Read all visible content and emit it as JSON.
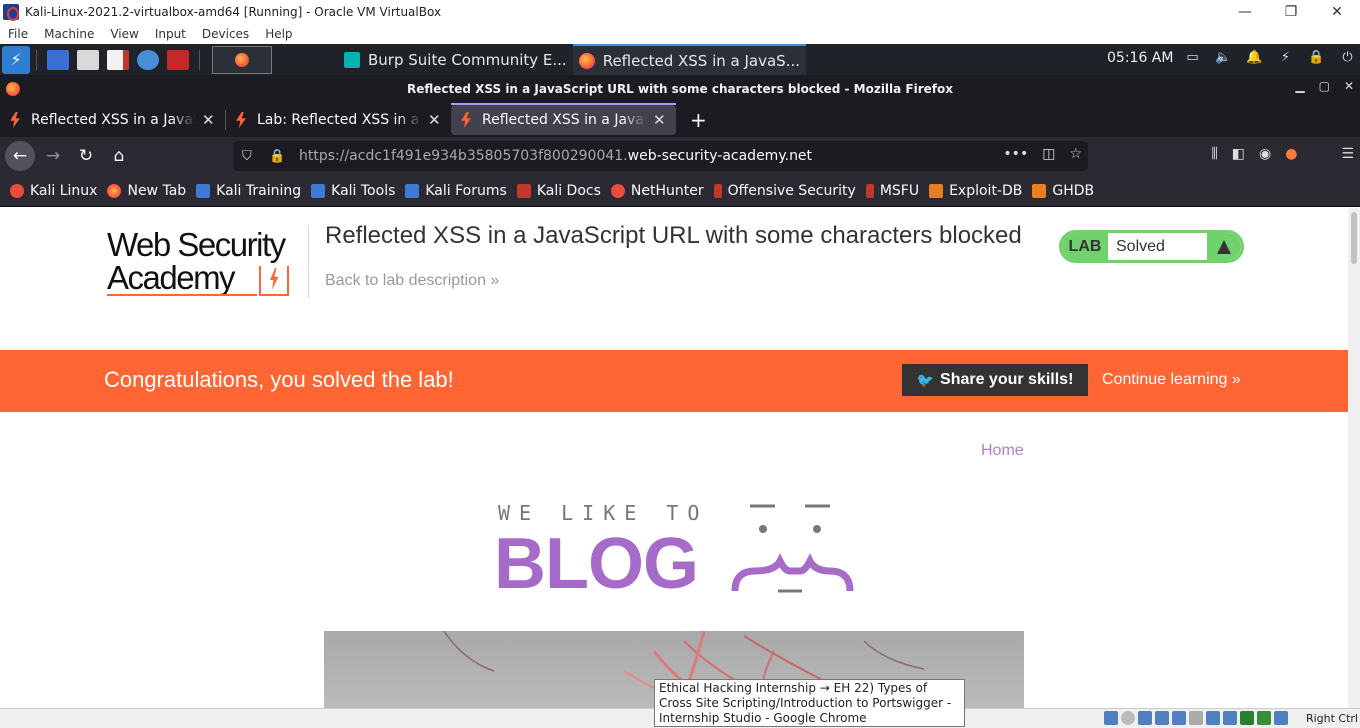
{
  "vbox": {
    "title": "Kali-Linux-2021.2-virtualbox-amd64 [Running] - Oracle VM VirtualBox",
    "menu": [
      "File",
      "Machine",
      "View",
      "Input",
      "Devices",
      "Help"
    ],
    "win_controls": [
      "—",
      "❐",
      "✕"
    ],
    "host_key": "Right Ctrl"
  },
  "panel": {
    "tasks": [
      {
        "label": "Burp Suite Community E..."
      },
      {
        "label": "Reflected XSS in a JavaS..."
      }
    ],
    "clock": "05:16 AM"
  },
  "firefox": {
    "window_title": "Reflected XSS in a JavaScript URL with some characters blocked - Mozilla Firefox",
    "tabs": [
      {
        "label": "Reflected XSS in a JavaScript URL with some characters blocked",
        "close": "✕"
      },
      {
        "label": "Lab: Reflected XSS in a JavaScript URL with some characters blocked",
        "close": "✕"
      },
      {
        "label": "Reflected XSS in a JavaScript URL with some characters blocked",
        "close": "✕"
      }
    ],
    "new_tab": "+",
    "url_prefix": "https://acdc1f491e934b35805703f800290041.",
    "url_host": "web-security-academy.net",
    "bookmarks": [
      "Kali Linux",
      "New Tab",
      "Kali Training",
      "Kali Tools",
      "Kali Forums",
      "Kali Docs",
      "NetHunter",
      "Offensive Security",
      "MSFU",
      "Exploit-DB",
      "GHDB"
    ]
  },
  "page": {
    "logo_line1": "Web Security",
    "logo_line2": "Academy",
    "lab_title": "Reflected XSS in a JavaScript URL with some characters blocked",
    "back_link": "Back to lab description »",
    "lab_tag": "LAB",
    "lab_status": "Solved",
    "congrats": "Congratulations, you solved the lab!",
    "share_button": "Share your skills!",
    "continue_link": "Continue learning »",
    "home_link": "Home",
    "blog_tagline": "WE LIKE TO",
    "blog_title": "BLOG"
  },
  "tooltip": {
    "text": "Ethical Hacking Internship → EH 22) Types of Cross Site Scripting/Introduction to Portswigger - Internship Studio - Google Chrome"
  },
  "colors": {
    "accent_orange": "#ff6633",
    "solved_green": "#70d16d",
    "blog_purple": "#a66bc9",
    "home_purple": "#b17ed4"
  }
}
